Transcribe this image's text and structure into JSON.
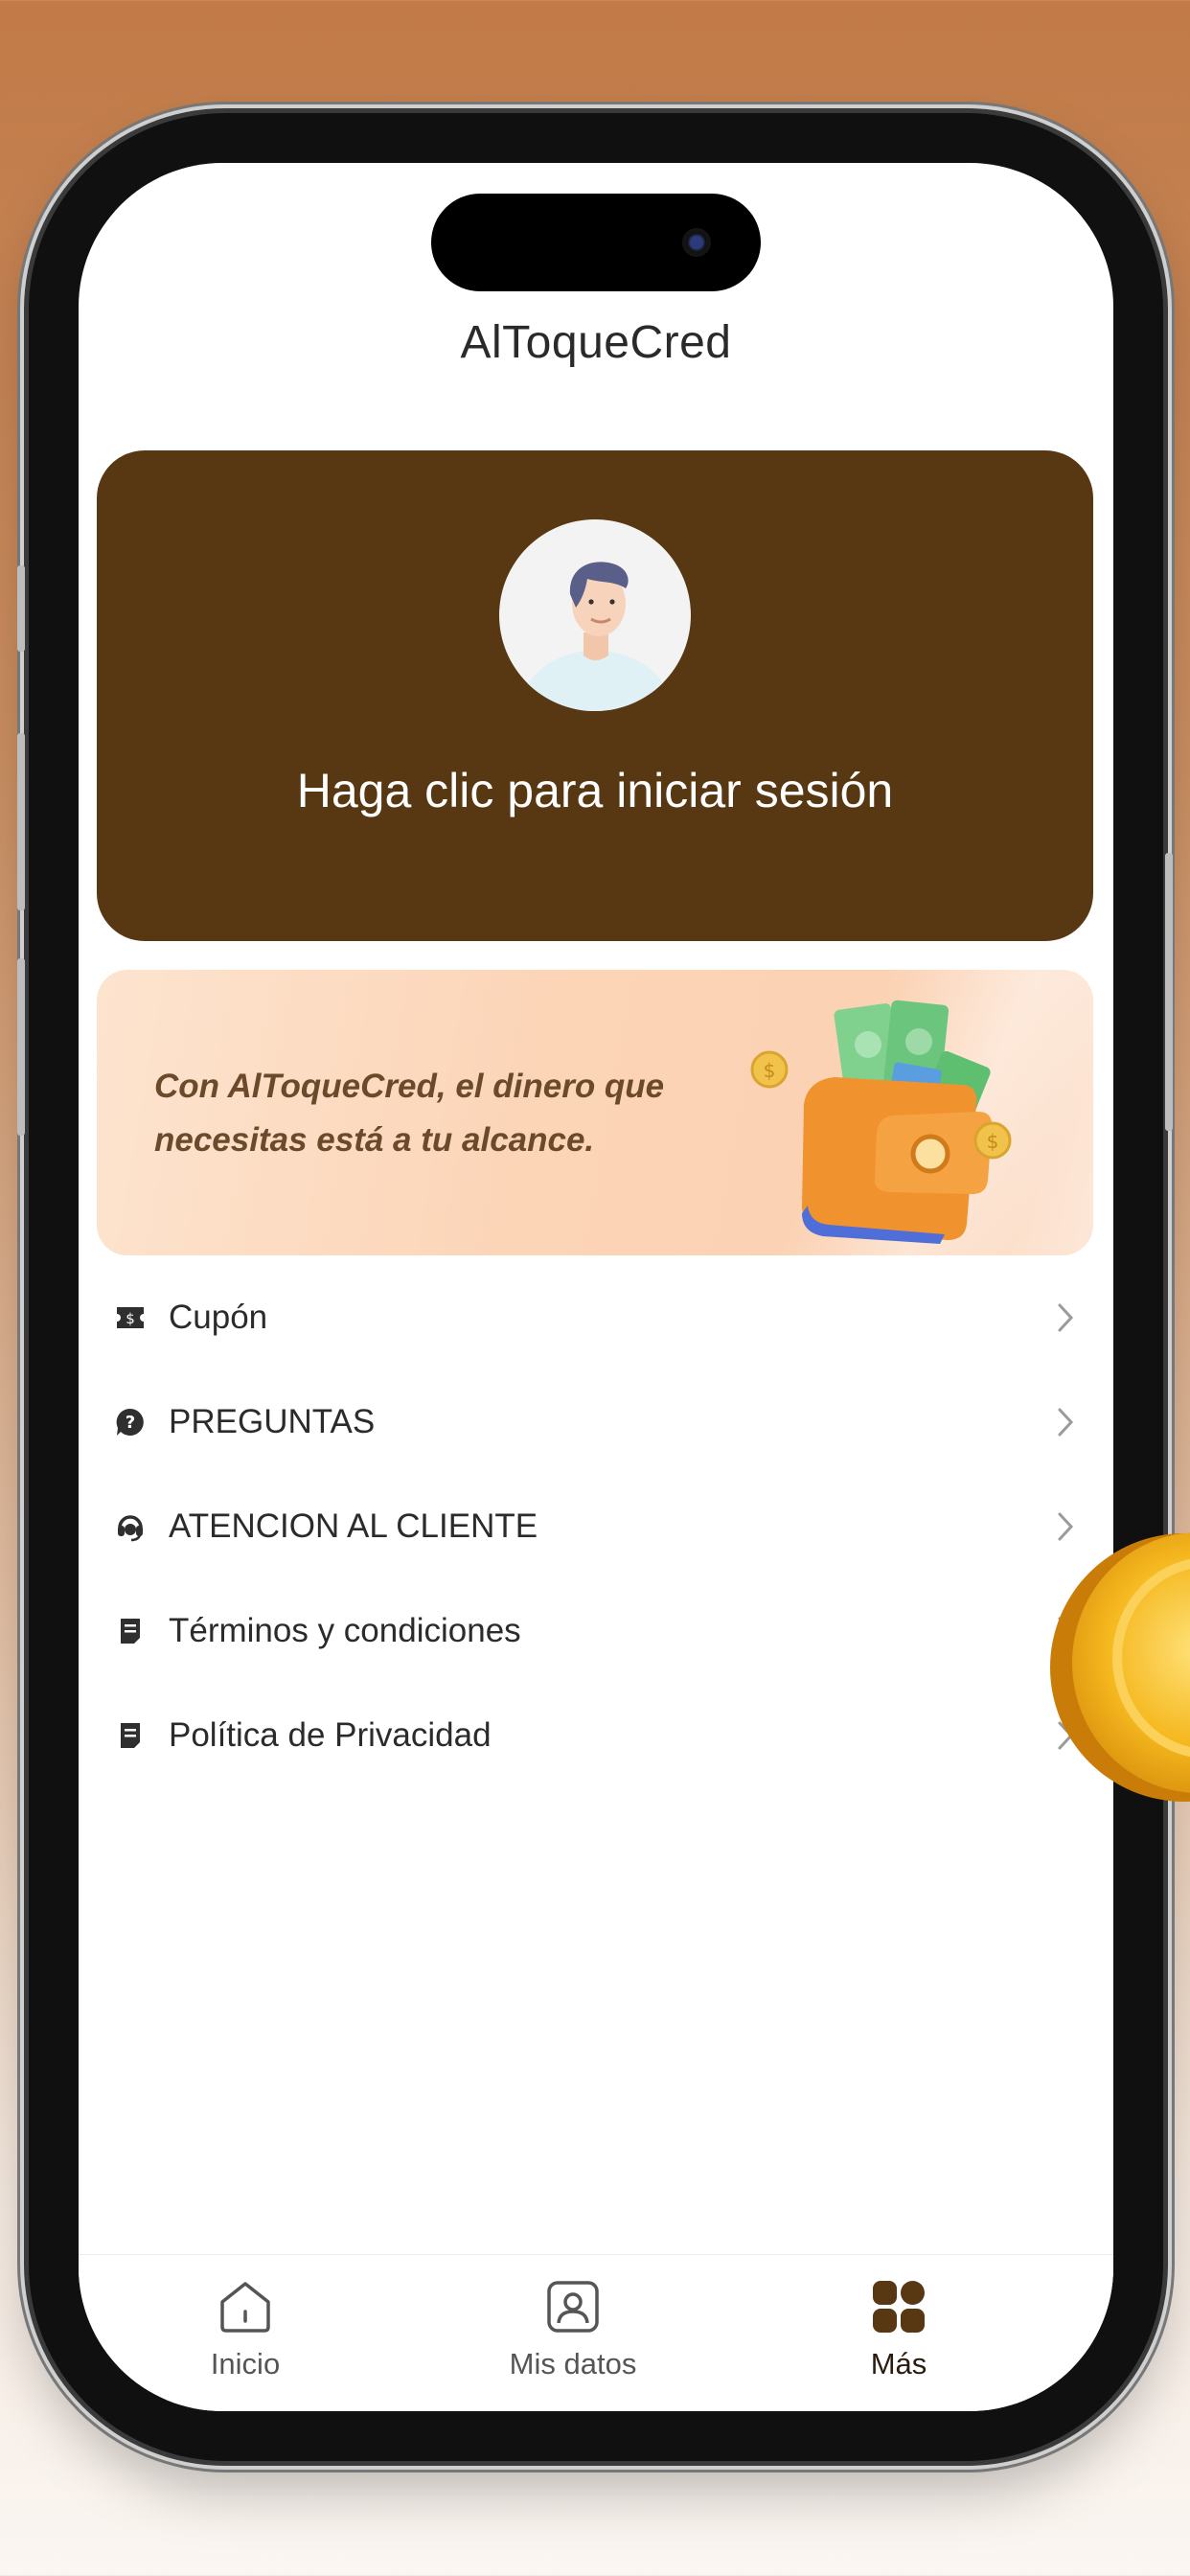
{
  "app": {
    "title": "AlToqueCred"
  },
  "login_card": {
    "text": "Haga clic para iniciar sesión",
    "bg_color": "#583812"
  },
  "banner": {
    "line1": "Con AlToqueCred, el dinero que",
    "line2": "necesitas está a tu alcance."
  },
  "menu": {
    "items": [
      {
        "label": "Cupón",
        "icon": "coupon-icon"
      },
      {
        "label": "PREGUNTAS",
        "icon": "question-icon"
      },
      {
        "label": "ATENCION AL CLIENTE",
        "icon": "headset-icon"
      },
      {
        "label": "Términos y condiciones",
        "icon": "document-icon"
      },
      {
        "label": "Política de Privacidad",
        "icon": "document-icon"
      }
    ]
  },
  "tabbar": {
    "tabs": [
      {
        "label": "Inicio",
        "icon": "home-icon",
        "active": false
      },
      {
        "label": "Mis datos",
        "icon": "profile-icon",
        "active": false
      },
      {
        "label": "Más",
        "icon": "grid-icon",
        "active": true
      }
    ]
  },
  "colors": {
    "accent": "#583812",
    "background_top": "#c17a48"
  }
}
